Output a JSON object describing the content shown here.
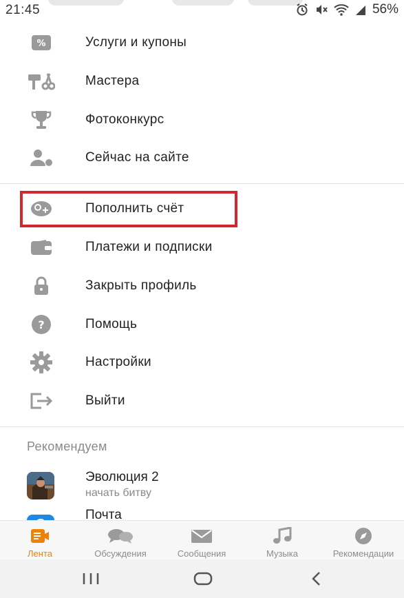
{
  "status_bar": {
    "time": "21:45",
    "battery": "56%",
    "icons": [
      "alarm-icon",
      "mute-icon",
      "wifi-icon",
      "signal-icon"
    ]
  },
  "menu": {
    "items": [
      {
        "label": "Услуги и купоны",
        "icon": "coupon-icon"
      },
      {
        "label": "Мастера",
        "icon": "masters-icon"
      },
      {
        "label": "Фотоконкурс",
        "icon": "trophy-icon"
      },
      {
        "label": "Сейчас на сайте",
        "icon": "users-online-icon"
      },
      {
        "label": "Пополнить счёт",
        "icon": "add-money-icon"
      },
      {
        "label": "Платежи и подписки",
        "icon": "wallet-icon"
      },
      {
        "label": "Закрыть профиль",
        "icon": "lock-icon"
      },
      {
        "label": "Помощь",
        "icon": "help-icon"
      },
      {
        "label": "Настройки",
        "icon": "gear-icon"
      },
      {
        "label": "Выйти",
        "icon": "logout-icon"
      }
    ]
  },
  "recommend": {
    "title": "Рекомендуем",
    "items": [
      {
        "title": "Эволюция 2",
        "subtitle": "начать битву",
        "icon": "game-thumbnail"
      },
      {
        "title": "Почта",
        "icon": "mail-app-thumbnail"
      }
    ]
  },
  "tabbar": {
    "active_color": "#ee8208",
    "tabs": [
      {
        "label": "Лента",
        "icon": "feed-icon",
        "active": true
      },
      {
        "label": "Обсуждения",
        "icon": "discussions-icon"
      },
      {
        "label": "Сообщения",
        "icon": "messages-icon"
      },
      {
        "label": "Музыка",
        "icon": "music-icon"
      },
      {
        "label": "Рекомендации",
        "icon": "compass-icon"
      }
    ]
  },
  "colors": {
    "icon_gray": "#9a9a9a",
    "highlight_red": "#d0282e"
  },
  "system_nav": [
    "recents-button",
    "home-button",
    "back-button"
  ]
}
